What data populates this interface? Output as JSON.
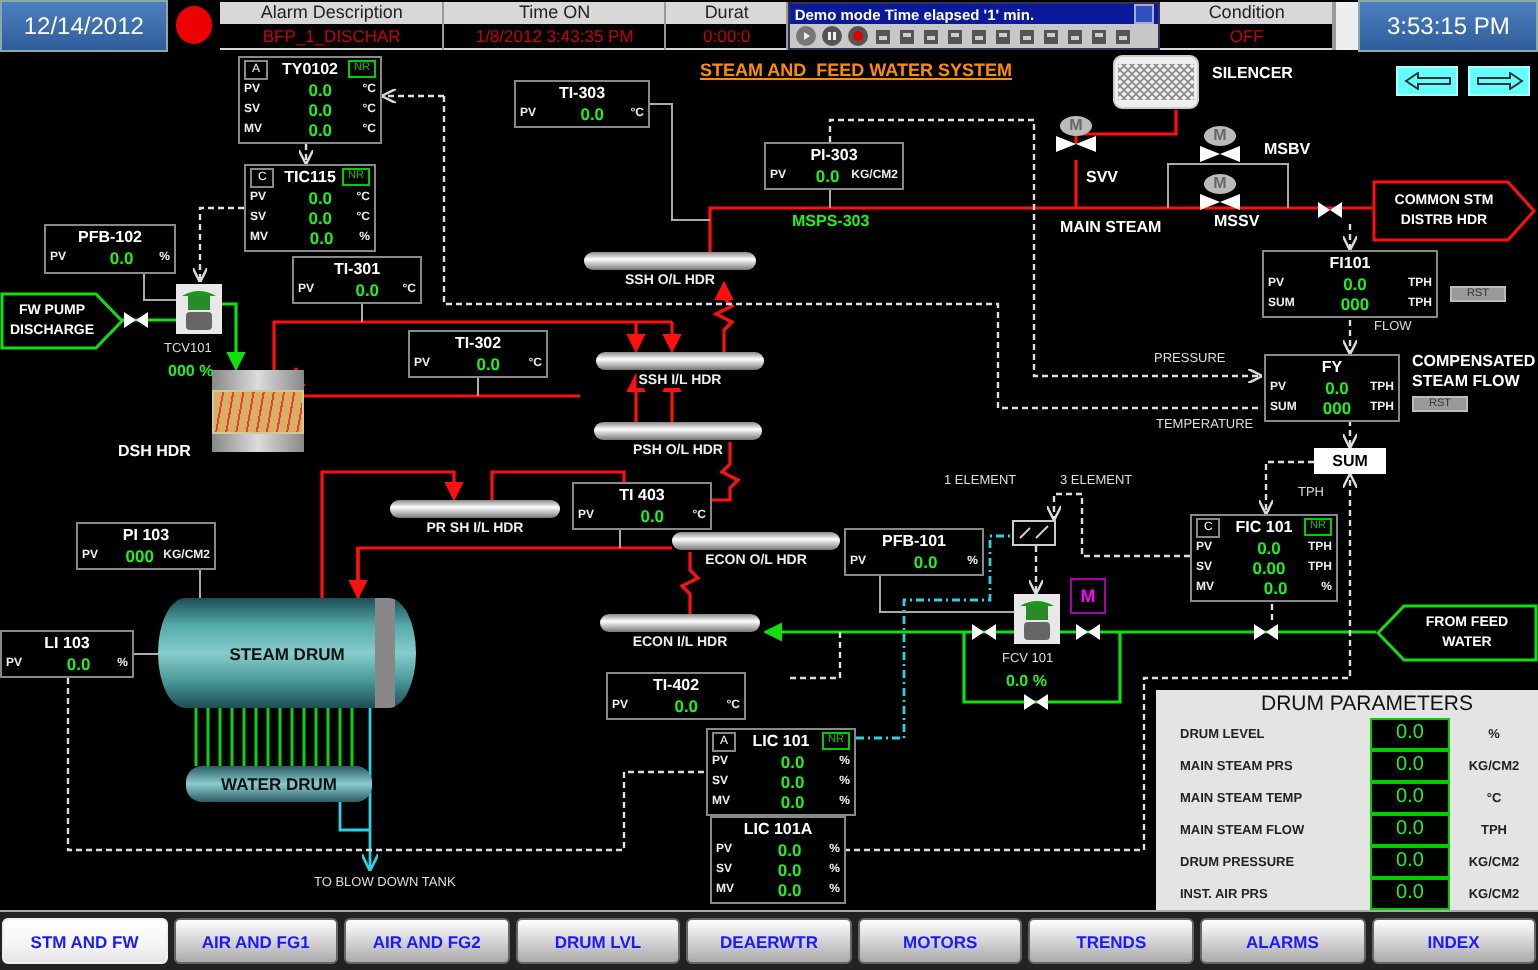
{
  "header": {
    "date": "12/14/2012",
    "time": "3:53:15 PM"
  },
  "alarm_table": {
    "columns": [
      "Alarm Description",
      "Time ON",
      "Durat",
      "Condition"
    ],
    "rows": [
      [
        "BFP_1_DISCHAR",
        "1/8/2012 3:43:35 PM",
        "0:00:0",
        "OFF"
      ]
    ]
  },
  "demo_popup": {
    "title": "Demo mode Time elapsed '1' min."
  },
  "title": "STEAM AND  FEED WATER SYSTEM",
  "faceplates": [
    {
      "tag": "TY0102",
      "mode": "A",
      "badge": "NR",
      "rows": [
        {
          "label": "PV",
          "value": "0.0",
          "unit": "°C"
        },
        {
          "label": "SV",
          "value": "0.0",
          "unit": "°C"
        },
        {
          "label": "MV",
          "value": "0.0",
          "unit": "°C"
        }
      ]
    },
    {
      "tag": "TIC115",
      "mode": "C",
      "badge": "NR",
      "rows": [
        {
          "label": "PV",
          "value": "0.0",
          "unit": "°C"
        },
        {
          "label": "SV",
          "value": "0.0",
          "unit": "°C"
        },
        {
          "label": "MV",
          "value": "0.0",
          "unit": "%"
        }
      ]
    },
    {
      "tag": "PFB-102",
      "rows": [
        {
          "label": "PV",
          "value": "0.0",
          "unit": "%"
        }
      ]
    },
    {
      "tag": "TI-303",
      "rows": [
        {
          "label": "PV",
          "value": "0.0",
          "unit": "°C"
        }
      ]
    },
    {
      "tag": "TI-301",
      "rows": [
        {
          "label": "PV",
          "value": "0.0",
          "unit": "°C"
        }
      ]
    },
    {
      "tag": "TI-302",
      "rows": [
        {
          "label": "PV",
          "value": "0.0",
          "unit": "°C"
        }
      ]
    },
    {
      "tag": "PI-303",
      "rows": [
        {
          "label": "PV",
          "value": "0.0",
          "unit": "KG/CM2"
        }
      ]
    },
    {
      "tag": "TI 403",
      "rows": [
        {
          "label": "PV",
          "value": "0.0",
          "unit": "°C"
        }
      ]
    },
    {
      "tag": "PI 103",
      "rows": [
        {
          "label": "PV",
          "value": "000",
          "unit": "KG/CM2"
        }
      ]
    },
    {
      "tag": "LI 103",
      "rows": [
        {
          "label": "PV",
          "value": "0.0",
          "unit": "%"
        }
      ]
    },
    {
      "tag": "PFB-101",
      "rows": [
        {
          "label": "PV",
          "value": "0.0",
          "unit": "%"
        }
      ]
    },
    {
      "tag": "TI-402",
      "rows": [
        {
          "label": "PV",
          "value": "0.0",
          "unit": "°C"
        }
      ]
    },
    {
      "tag": "LIC 101",
      "mode": "A",
      "badge": "NR",
      "rows": [
        {
          "label": "PV",
          "value": "0.0",
          "unit": "%"
        },
        {
          "label": "SV",
          "value": "0.0",
          "unit": "%"
        },
        {
          "label": "MV",
          "value": "0.0",
          "unit": "%"
        }
      ]
    },
    {
      "tag": "LIC 101A",
      "rows": [
        {
          "label": "PV",
          "value": "0.0",
          "unit": "%"
        },
        {
          "label": "SV",
          "value": "0.0",
          "unit": "%"
        },
        {
          "label": "MV",
          "value": "0.0",
          "unit": "%"
        }
      ]
    },
    {
      "tag": "FI101",
      "reset": "RST",
      "rows": [
        {
          "label": "PV",
          "value": "0.0",
          "unit": "TPH"
        },
        {
          "label": "SUM",
          "value": "000",
          "unit": "TPH"
        }
      ]
    },
    {
      "tag": "FY",
      "reset": "RST",
      "rows": [
        {
          "label": "PV",
          "value": "0.0",
          "unit": "TPH"
        },
        {
          "label": "SUM",
          "value": "000",
          "unit": "TPH"
        }
      ]
    },
    {
      "tag": "FIC 101",
      "mode": "C",
      "badge": "NR",
      "rows": [
        {
          "label": "PV",
          "value": "0.0",
          "unit": "TPH"
        },
        {
          "label": "SV",
          "value": "0.00",
          "unit": "TPH"
        },
        {
          "label": "MV",
          "value": "0.0",
          "unit": "%"
        }
      ]
    }
  ],
  "headers": [
    "SSH O/L HDR",
    "SSH I/L HDR",
    "PSH O/L HDR",
    "PR SH I/L HDR",
    "ECON O/L HDR",
    "ECON I/L HDR"
  ],
  "drums": [
    "STEAM DRUM",
    "WATER DRUM"
  ],
  "connectors": [
    {
      "text": "FW PUMP DISCHARGE",
      "kind": "water"
    },
    {
      "text": "COMMON STM DISTRB HDR",
      "kind": "steam"
    },
    {
      "text": "FROM FEED WATER",
      "kind": "water"
    }
  ],
  "motor_valves": [
    {
      "label": "SVV",
      "actuator": "M"
    },
    {
      "label": "MSBV",
      "actuator": "M"
    },
    {
      "label": "MSSV",
      "actuator": "M"
    }
  ],
  "control_valves": [
    {
      "tag": "TCV101",
      "output": "000 %"
    },
    {
      "tag": "FCV 101",
      "output": "0.0 %"
    }
  ],
  "notes": [
    {
      "text": "SILENCER",
      "kind": "label"
    },
    {
      "text": "MAIN STEAM",
      "kind": "label"
    },
    {
      "text": "MSPS-303",
      "kind": "tag"
    },
    {
      "text": "FLOW",
      "kind": "small"
    },
    {
      "text": "PRESSURE",
      "kind": "small"
    },
    {
      "text": "TEMPERATURE",
      "kind": "small"
    },
    {
      "text": "COMPENSATED STEAM FLOW",
      "kind": "label"
    },
    {
      "text": "TPH",
      "kind": "small"
    },
    {
      "text": "1 ELEMENT",
      "kind": "small"
    },
    {
      "text": "3 ELEMENT",
      "kind": "small"
    },
    {
      "text": "DSH HDR",
      "kind": "label"
    },
    {
      "text": "TO BLOW DOWN TANK",
      "kind": "small"
    }
  ],
  "sum_block": "SUM",
  "manual_indicator": "M",
  "drum_parameters": {
    "title": "DRUM PARAMETERS",
    "rows": [
      {
        "label": "DRUM LEVEL",
        "value": "0.0",
        "unit": "%"
      },
      {
        "label": "MAIN STEAM PRS",
        "value": "0.0",
        "unit": "KG/CM2"
      },
      {
        "label": "MAIN STEAM TEMP",
        "value": "0.0",
        "unit": "°C"
      },
      {
        "label": "MAIN STEAM FLOW",
        "value": "0.0",
        "unit": "TPH"
      },
      {
        "label": "DRUM PRESSURE",
        "value": "0.0",
        "unit": "KG/CM2"
      },
      {
        "label": "INST. AIR PRS",
        "value": "0.0",
        "unit": "KG/CM2"
      }
    ]
  },
  "nav": [
    {
      "label": "STM AND FW",
      "selected": true
    },
    {
      "label": "AIR AND FG1",
      "selected": false
    },
    {
      "label": "AIR AND FG2",
      "selected": false
    },
    {
      "label": "DRUM LVL",
      "selected": false
    },
    {
      "label": "DEAERWTR",
      "selected": false
    },
    {
      "label": "MOTORS",
      "selected": false
    },
    {
      "label": "TRENDS",
      "selected": false
    },
    {
      "label": "ALARMS",
      "selected": false
    },
    {
      "label": "INDEX",
      "selected": false
    }
  ]
}
